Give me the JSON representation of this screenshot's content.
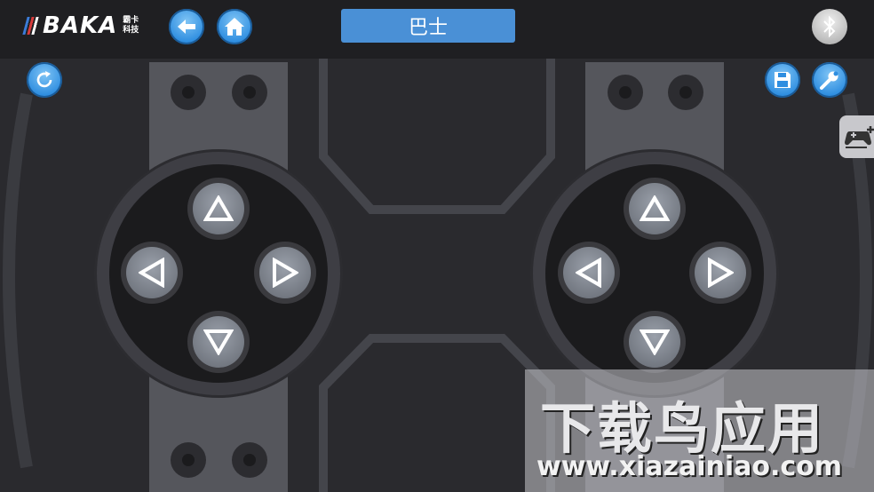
{
  "app": {
    "brand": "BAKA",
    "brand_sub_line1": "霸卡",
    "brand_sub_line2": "科技",
    "title": "巴士"
  },
  "icons": {
    "back": "arrow-left-icon",
    "home": "home-icon",
    "bluetooth": "bluetooth-icon",
    "refresh": "refresh-icon",
    "save": "save-icon",
    "settings": "wrench-icon",
    "gamepad": "gamepad-add-icon"
  },
  "colors": {
    "accent": "#4a90d6",
    "button_blue": "#2f8ee0",
    "background": "#2a2a2e"
  },
  "watermark": {
    "title": "下载鸟应用",
    "url": "www.xiazainiao.com"
  }
}
